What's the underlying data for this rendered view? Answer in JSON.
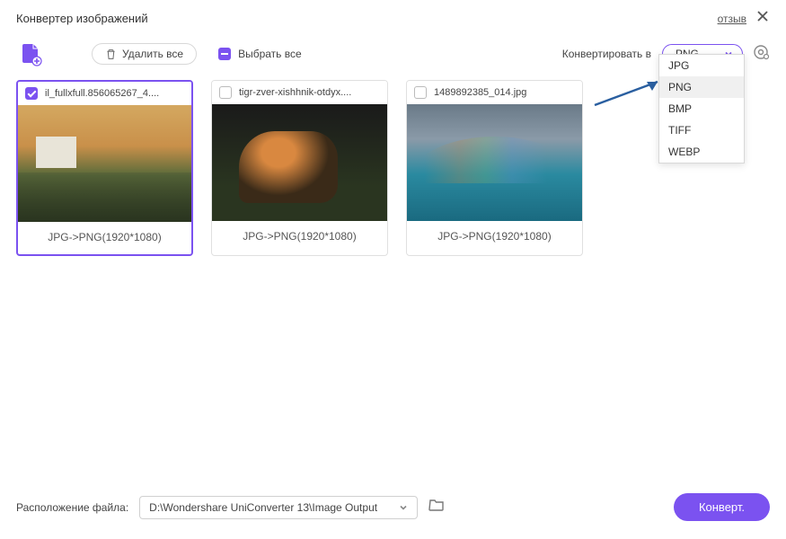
{
  "header": {
    "title": "Конвертер изображений",
    "feedback": "отзыв"
  },
  "toolbar": {
    "delete_all": "Удалить все",
    "select_all": "Выбрать все",
    "convert_to_label": "Конвертировать в",
    "selected_format": "PNG"
  },
  "dropdown_options": [
    {
      "label": "JPG",
      "active": false
    },
    {
      "label": "PNG",
      "active": true
    },
    {
      "label": "BMP",
      "active": false
    },
    {
      "label": "TIFF",
      "active": false
    },
    {
      "label": "WEBP",
      "active": false
    }
  ],
  "files": [
    {
      "name": "il_fullxfull.856065267_4....",
      "checked": true,
      "info": "JPG->PNG(1920*1080)"
    },
    {
      "name": "tigr-zver-xishhnik-otdyx....",
      "checked": false,
      "info": "JPG->PNG(1920*1080)"
    },
    {
      "name": "1489892385_014.jpg",
      "checked": false,
      "info": "JPG->PNG(1920*1080)"
    }
  ],
  "footer": {
    "location_label": "Расположение файла:",
    "path": "D:\\Wondershare UniConverter 13\\Image Output",
    "convert_button": "Конверт."
  }
}
